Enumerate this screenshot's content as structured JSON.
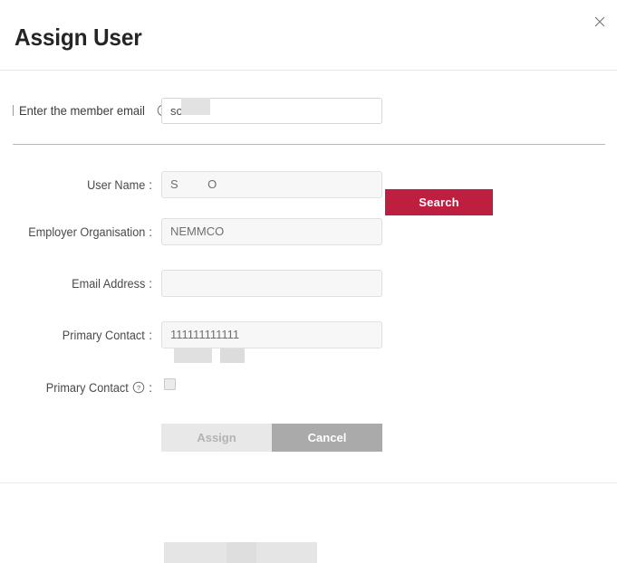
{
  "dialog": {
    "title": "Assign User",
    "close_icon": "close-icon"
  },
  "search": {
    "label": "Enter the member email",
    "help_icon": "help-circle-icon",
    "colon": ":",
    "input_value": "so",
    "input_placeholder": "",
    "button_label": "Search",
    "button_color": "#be1e40"
  },
  "form": {
    "rows": [
      {
        "label": "User Name",
        "colon": ":",
        "value": "S        O",
        "type": "text",
        "readonly": true,
        "redacted": true
      },
      {
        "label": "Employer Organisation",
        "colon": ":",
        "value": "NEMMCO",
        "type": "text",
        "readonly": true,
        "redacted": false
      },
      {
        "label": "Email Address",
        "colon": ":",
        "value": "",
        "type": "text",
        "readonly": true,
        "redacted": true
      },
      {
        "label": "Primary Contact",
        "colon": ":",
        "value": "111111111111",
        "type": "text",
        "readonly": true,
        "redacted": false
      },
      {
        "label": "Primary Contact",
        "colon": ":",
        "value": "",
        "type": "checkbox",
        "checked": false,
        "help_icon": "help-circle-icon"
      }
    ]
  },
  "actions": {
    "assign_label": "Assign",
    "assign_disabled": true,
    "cancel_label": "Cancel"
  }
}
